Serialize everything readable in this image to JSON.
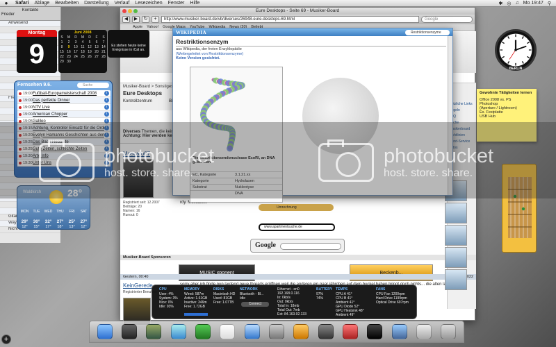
{
  "menubar": {
    "app": "Safari",
    "menus": [
      "Ablage",
      "Bearbeiten",
      "Darstellung",
      "Verlauf",
      "Lesezeichen",
      "Fenster",
      "Hilfe"
    ],
    "clock": "Mo 19:47",
    "disk": "Macintosh HD"
  },
  "contacts": {
    "title": "Kontakte",
    "rows": [
      "Frieder",
      "Anwesend",
      "",
      "",
      "",
      "",
      "",
      "",
      "",
      "",
      "",
      "",
      "",
      "Fremde",
      "",
      "",
      "",
      "",
      "",
      "",
      "",
      "",
      "",
      "",
      "",
      "",
      "",
      "",
      "",
      "",
      "",
      "",
      "Gitarre",
      "Wayne",
      "Nicht erreichbar"
    ]
  },
  "browser": {
    "title": "Eure Desktops - Seite 69 - Musiker-Board",
    "url": "http://www.musiker-board.de/vb/diverses/26948-eure-desktops-69.html",
    "search_placeholder": "Google",
    "bookmarks": [
      "Apple",
      "Yahoo!",
      "Google Maps",
      "YouTube",
      "Wikipedia",
      "News (20)",
      "Beliebt"
    ],
    "breadcrumb": "Musiker-Board > Sonstiges >",
    "thread_title": "Eure Desktops",
    "tabs": [
      "Kontrollzentrum",
      "Bilder"
    ],
    "notice_title": "Diverses",
    "notice_text": "Themen, die keinem a...",
    "notice_warn": "Achtung: Hier werden keine P...",
    "right_links": [
      "Nützliche Links",
      "Regeln",
      "FAQ",
      "Suche",
      "Musikerboard",
      "Richtlinien",
      "Rund-Service",
      "Fotos"
    ],
    "post1": {
      "user": "Moscato07",
      "meta": "Registriert seit: 12.2007\nBeiträge: 20\nNamen: 16\nRunout: 0",
      "body": "rdy. Moscato07"
    },
    "sponsors": "Musiker-Board Sponsoren",
    "ads": [
      "MUSIC xponent",
      "Beckenb..."
    ],
    "post2_date": "Gestern, 00:40",
    "post2_number": "#1022",
    "post2": {
      "user": "KeinGerede",
      "meta": "Registrierter Benutzer",
      "body": "sorry aber ich finde nun laufend neue threads eröffnen weil die anderen ein paar jährchen auf dem buckel haben bringt doch nichts... die alten laufen doch prima"
    }
  },
  "wikipedia": {
    "logo": "WIKIPEDIA",
    "search": "Restriktionsenzyme",
    "title": "Restriktionsenzym",
    "source": "aus Wikipedia, der freien Enzyklopädie",
    "redirect": "(Weitergeleitet von Restriktionsenzyme)",
    "version": "Keine Version gesichtet.",
    "caption": "Die Restriktionsendonuclease EcoRI, an DNA gebunden",
    "infobox": [
      {
        "k": "EC, Kategorie",
        "v": "3.1.21.xx"
      },
      {
        "k": "Kategorie",
        "v": "Hydrolasen"
      },
      {
        "k": "Substrat",
        "v": "Nukleotyse"
      },
      {
        "k": "",
        "v": "DNA"
      }
    ]
  },
  "calendar": {
    "day_name": "Montag",
    "day_number": "9",
    "month": "Juni 2008",
    "weekdays": [
      "S",
      "M",
      "D",
      "M",
      "D",
      "F",
      "S"
    ],
    "days": [
      "",
      "",
      "",
      "",
      "",
      "",
      "",
      "1",
      "2",
      "3",
      "4",
      "5",
      "6",
      "7",
      "8",
      "9",
      "10",
      "11",
      "12",
      "13",
      "14",
      "15",
      "16",
      "17",
      "18",
      "19",
      "20",
      "21",
      "22",
      "23",
      "24",
      "25",
      "26",
      "27",
      "28",
      "29",
      "30",
      "",
      "",
      "",
      "",
      ""
    ],
    "today": "9",
    "events": "Es stehen heute keine Ereignisse in iCal an."
  },
  "tv": {
    "title": "Fernsehen 9.6.",
    "search_placeholder": "Suche",
    "rows": [
      {
        "time": "19:00",
        "show": "Fußball-Europameisterschaft 2008"
      },
      {
        "time": "19:00",
        "show": "Das perfekte Dinner"
      },
      {
        "time": "19:00",
        "show": "NTV Live"
      },
      {
        "time": "19:00",
        "show": "American Chopper"
      },
      {
        "time": "19:05",
        "show": "Galileo"
      },
      {
        "time": "19:15",
        "show": "Achtung, Kontrolle! Einsatz für die Ordnungshüter"
      },
      {
        "time": "19:20",
        "show": "Evelyn Hamanns Geschichten aus dem Leben"
      },
      {
        "time": "19:25",
        "show": "Das Bad / Heppsite"
      },
      {
        "time": "19:25",
        "show": "Gute Zeiten, schlechte Zeiten"
      },
      {
        "time": "19:30",
        "show": "Arte Info"
      },
      {
        "time": "19:30",
        "show": "Unter Uns"
      }
    ]
  },
  "weather": {
    "city": "Waldkirch",
    "temp": "28°",
    "days": [
      "MON",
      "TUE",
      "WED",
      "THU",
      "FRI",
      "SAT"
    ],
    "hi": [
      "29°",
      "30°",
      "32°",
      "27°",
      "25°",
      "27°"
    ],
    "lo": [
      "12°",
      "15°",
      "17°",
      "18°",
      "13°",
      "12°"
    ]
  },
  "istat": {
    "cpu": {
      "h": "CPU",
      "lines": [
        "User: 4%",
        "System: 3%",
        "Nice: 0%",
        "Idle: 93%"
      ]
    },
    "memory": {
      "h": "MEMORY",
      "lines": [
        "Wired: 587m",
        "Active: 1.61GB",
        "Inactive: 346m",
        "Free: 1.72GB"
      ]
    },
    "disks": {
      "h": "DISKS",
      "lines": [
        "Macintosh HD",
        "Used: 81GB",
        "Free: 1.07TB"
      ]
    },
    "network": {
      "h": "NETWORK",
      "lines": [
        "Bluetooth - Bl...",
        "Idle"
      ]
    },
    "ethernet": {
      "lines": [
        "Ethernet - en0",
        "192.168.0.116",
        "In: 0kb/s",
        "Out: 0kb/s",
        "Total In: 18mb",
        "Total Out: 7mb",
        "Ext: 84.163.92.133"
      ]
    },
    "battery": {
      "h": "BATTERY",
      "lines": [
        "97%",
        "74%"
      ]
    },
    "temps": {
      "h": "TEMPS",
      "lines": [
        "CPU A 41°",
        "CPU B 41°",
        "Ambient 41°",
        "GPU Diode 52°",
        "GPU Heatsink 48°",
        "Ambient 49°",
        "Mem Controller 52°",
        "Airport Card 45°"
      ]
    },
    "fans": {
      "h": "FANS",
      "lines": [
        "CPU Fan 1200rpm",
        "Hard Drive 1199rpm",
        "Optical Drive 697rpm"
      ]
    },
    "connect": "Connect"
  },
  "clock": {
    "city": "BERLIN"
  },
  "sticky": {
    "title": "Gewohnte Tätigkeiten lernen",
    "lines": [
      "Office 2008 vs. PS",
      "Photoshop",
      "(Aperture / Lightroom)",
      "Ex. Festplatte",
      "USB Hub"
    ]
  },
  "widgets": {
    "search_hint": "www.apartmentsuche.de",
    "currency": "Umrechnung",
    "google": "Google"
  },
  "watermark": {
    "brand": "photobucket",
    "tagline": "host. store. share."
  }
}
